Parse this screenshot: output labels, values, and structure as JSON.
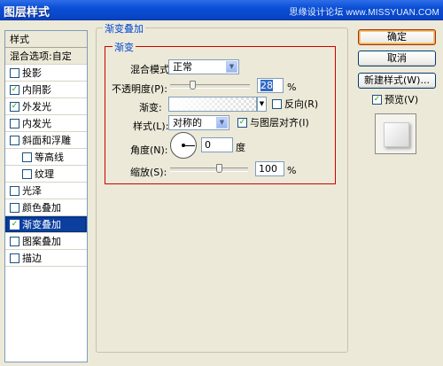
{
  "window": {
    "title": "图层样式",
    "watermark": "思缘设计论坛 www.MISSYUAN.COM"
  },
  "style_list": {
    "header": "样式",
    "blend_options": "混合选项:自定",
    "items": [
      {
        "label": "投影",
        "checked": false,
        "sub": false
      },
      {
        "label": "内阴影",
        "checked": true,
        "sub": false
      },
      {
        "label": "外发光",
        "checked": true,
        "sub": false
      },
      {
        "label": "内发光",
        "checked": false,
        "sub": false
      },
      {
        "label": "斜面和浮雕",
        "checked": false,
        "sub": false
      },
      {
        "label": "等高线",
        "checked": false,
        "sub": true
      },
      {
        "label": "纹理",
        "checked": false,
        "sub": true
      },
      {
        "label": "光泽",
        "checked": false,
        "sub": false
      },
      {
        "label": "颜色叠加",
        "checked": false,
        "sub": false
      },
      {
        "label": "渐变叠加",
        "checked": true,
        "sub": false,
        "selected": true
      },
      {
        "label": "图案叠加",
        "checked": false,
        "sub": false
      },
      {
        "label": "描边",
        "checked": false,
        "sub": false
      }
    ]
  },
  "panel": {
    "outer_title": "渐变叠加",
    "inner_title": "渐变",
    "blend_mode_label": "混合模式:",
    "blend_mode_value": "正常",
    "opacity_label": "不透明度(P):",
    "opacity_value": "28",
    "opacity_unit": "%",
    "gradient_label": "渐变:",
    "reverse_label": "反向(R)",
    "reverse_checked": false,
    "style_label": "样式(L):",
    "style_value": "对称的",
    "align_label": "与图层对齐(I)",
    "align_checked": true,
    "angle_label": "角度(N):",
    "angle_value": "0",
    "angle_unit": "度",
    "scale_label": "缩放(S):",
    "scale_value": "100",
    "scale_unit": "%"
  },
  "buttons": {
    "ok": "确定",
    "cancel": "取消",
    "new_style": "新建样式(W)...",
    "preview_label": "预览(V)",
    "preview_checked": true
  },
  "check_glyph": "✓"
}
